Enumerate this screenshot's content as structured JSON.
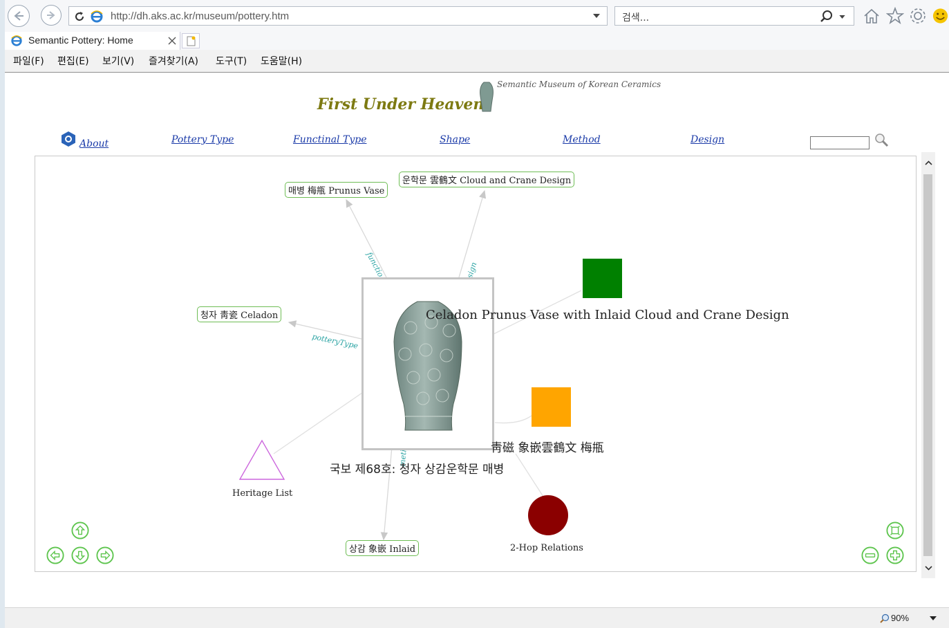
{
  "browser": {
    "url": "http://dh.aks.ac.kr/museum/pottery.htm",
    "search_placeholder": "검색...",
    "tab_title": "Semantic Pottery: Home",
    "menu": [
      "파일(F)",
      "편집(E)",
      "보기(V)",
      "즐겨찾기(A)",
      "도구(T)",
      "도움말(H)"
    ],
    "zoom": "90%"
  },
  "site": {
    "subtitle": "Semantic Museum of Korean Ceramics",
    "title": "First Under Heaven",
    "nav": [
      "About",
      "Pottery Type",
      "Functinal Type",
      "Shape",
      "Method",
      "Design"
    ]
  },
  "graph": {
    "nodes": {
      "prunus_vase": "매병 梅甁 Prunus Vase",
      "cloud_crane": "운학문 雲鶴文 Cloud and Crane Design",
      "celadon": "청자 靑瓷 Celadon",
      "inlaid": "상감 象嵌 Inlaid",
      "heritage_list": "Heritage List",
      "two_hop": "2-Hop Relations"
    },
    "center_label_en": "Celadon Prunus Vase with Inlaid Cloud and Crane Design",
    "center_label_hanja": "靑磁 象嵌雲鶴文 梅甁",
    "center_label_ko": "국보 제68호: 청자 상감운학문 매병",
    "edge_labels": {
      "function": "functio",
      "design": "sign",
      "pottery_type": "potteryType",
      "method": "meth"
    }
  },
  "colors": {
    "green_square": "#008000",
    "orange_square": "#ffa500",
    "red_circle": "#8b0000",
    "triangle": "#cc66dd",
    "node_border": "#6ebd54"
  }
}
